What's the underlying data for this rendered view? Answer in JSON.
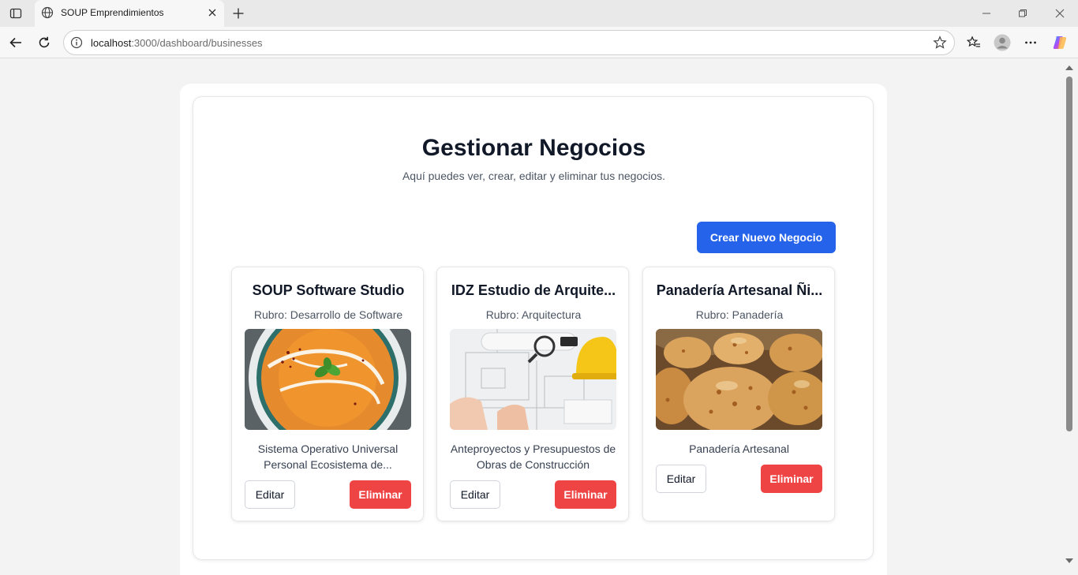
{
  "browser": {
    "tab_title": "SOUP Emprendimientos",
    "url_host": "localhost",
    "url_rest": ":3000/dashboard/businesses"
  },
  "page": {
    "title": "Gestionar Negocios",
    "subtitle": "Aquí puedes ver, crear, editar y eliminar tus negocios.",
    "create_button": "Crear Nuevo Negocio"
  },
  "businesses": [
    {
      "name": "SOUP Software Studio",
      "rubro": "Rubro: Desarrollo de Software",
      "description": "Sistema Operativo Universal Personal Ecosistema de...",
      "image": "soup-bowl-image",
      "edit_label": "Editar",
      "delete_label": "Eliminar"
    },
    {
      "name": "IDZ Estudio de Arquite...",
      "rubro": "Rubro: Arquitectura",
      "description": "Anteproyectos y Presupuestos de Obras de Construcción",
      "image": "architecture-plans-image",
      "edit_label": "Editar",
      "delete_label": "Eliminar"
    },
    {
      "name": "Panadería Artesanal Ñi...",
      "rubro": "Rubro: Panadería",
      "description": "Panadería Artesanal",
      "image": "bread-rolls-image",
      "edit_label": "Editar",
      "delete_label": "Eliminar"
    }
  ],
  "colors": {
    "primary": "#2563eb",
    "danger": "#ef4444",
    "title": "#111827"
  }
}
